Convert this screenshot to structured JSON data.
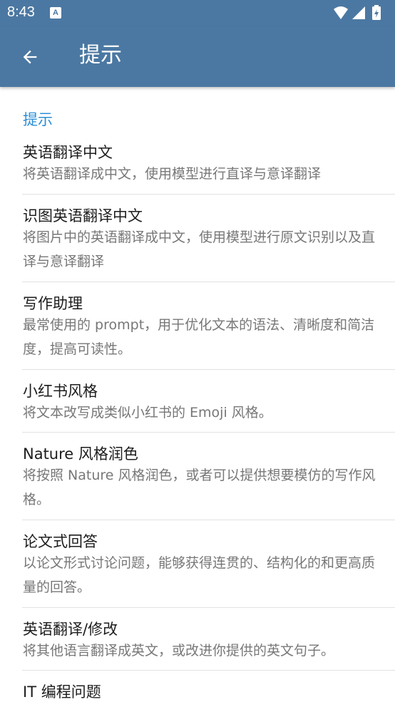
{
  "status_bar": {
    "time": "8:43",
    "notification_icon": "A"
  },
  "app_bar": {
    "back_icon": "arrow-back-icon",
    "title": "提示"
  },
  "section": {
    "header": "提示"
  },
  "items": [
    {
      "title": "英语翻译中文",
      "description": "将英语翻译成中文，使用模型进行直译与意译翻译"
    },
    {
      "title": "识图英语翻译中文",
      "description": "将图片中的英语翻译成中文，使用模型进行原文识别以及直译与意译翻译"
    },
    {
      "title": "写作助理",
      "description": "最常使用的 prompt，用于优化文本的语法、清晰度和简洁度，提高可读性。"
    },
    {
      "title": "小红书风格",
      "description": "将文本改写成类似小红书的 Emoji 风格。"
    },
    {
      "title": "Nature 风格润色",
      "description": "将按照 Nature 风格润色，或者可以提供想要模仿的写作风格。"
    },
    {
      "title": "论文式回答",
      "description": "以论文形式讨论问题，能够获得连贯的、结构化的和更高质量的回答。"
    },
    {
      "title": "英语翻译/修改",
      "description": "将其他语言翻译成英文，或改进你提供的英文句子。"
    },
    {
      "title": "IT 编程问题",
      "description": ""
    }
  ],
  "colors": {
    "app_bar": "#4b78a2",
    "section_header": "#2c8fd6",
    "title_text": "#1c1c1c",
    "desc_text": "#777777",
    "divider": "#e2e2e2"
  }
}
